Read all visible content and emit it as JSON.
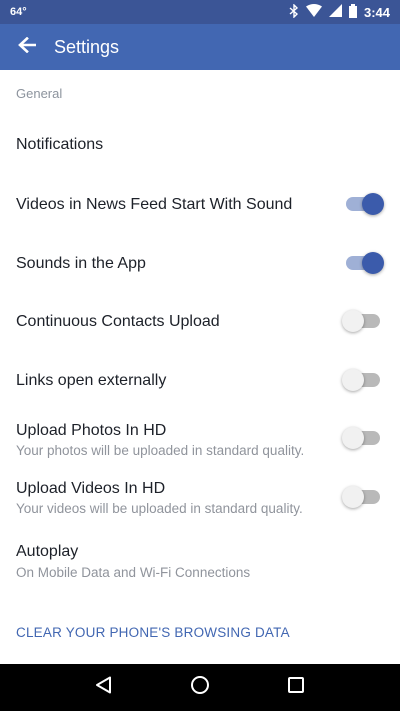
{
  "status_bar": {
    "temperature": "64°",
    "time": "3:44"
  },
  "app_bar": {
    "title": "Settings",
    "back_icon": "arrow-left-icon"
  },
  "section": {
    "header": "General"
  },
  "settings": {
    "notifications": {
      "title": "Notifications"
    },
    "videos_sound": {
      "title": "Videos in News Feed Start With Sound",
      "enabled": true
    },
    "sounds_app": {
      "title": "Sounds in the App",
      "enabled": true
    },
    "contacts_upload": {
      "title": "Continuous Contacts Upload",
      "enabled": false
    },
    "links_external": {
      "title": "Links open externally",
      "enabled": false
    },
    "photos_hd": {
      "title": "Upload Photos In HD",
      "subtitle": "Your photos will be uploaded in standard quality.",
      "enabled": false
    },
    "videos_hd": {
      "title": "Upload Videos In HD",
      "subtitle": "Your videos will be uploaded in standard quality.",
      "enabled": false
    },
    "autoplay": {
      "title": "Autoplay",
      "subtitle": "On Mobile Data and Wi-Fi Connections"
    }
  },
  "clear_data": {
    "label": "CLEAR YOUR PHONE'S BROWSING DATA"
  },
  "colors": {
    "status_bar": "#3b5596",
    "app_bar": "#4267b2",
    "toggle_on_knob": "#3b5bab",
    "toggle_on_track": "#9fb0d6",
    "toggle_off_track": "#b9b9b9",
    "link": "#4267b2"
  }
}
